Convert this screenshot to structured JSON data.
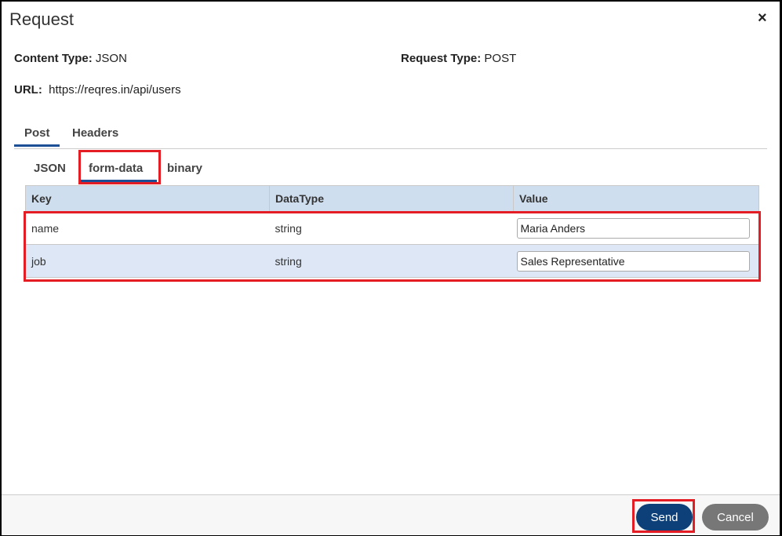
{
  "dialog": {
    "title": "Request",
    "close_icon": "×"
  },
  "info": {
    "content_type_label": "Content Type:",
    "content_type": "JSON",
    "request_type_label": "Request Type:",
    "request_type": "POST",
    "url_label": "URL:",
    "url": "https://reqres.in/api/users"
  },
  "tabs": [
    {
      "label": "Post"
    },
    {
      "label": "Headers"
    }
  ],
  "subtabs": [
    {
      "label": "JSON"
    },
    {
      "label": "form-data"
    },
    {
      "label": "binary"
    }
  ],
  "table": {
    "headers": [
      "Key",
      "DataType",
      "Value"
    ],
    "rows": [
      {
        "key": "name",
        "type": "string",
        "value": "Maria Anders"
      },
      {
        "key": "job",
        "type": "string",
        "value": "Sales Representative"
      }
    ]
  },
  "footer": {
    "send": "Send",
    "cancel": "Cancel"
  },
  "colors": {
    "accent": "#1c4f95",
    "send_bg": "#0d3f78",
    "cancel_bg": "#777777",
    "highlight": "#e41c23"
  }
}
